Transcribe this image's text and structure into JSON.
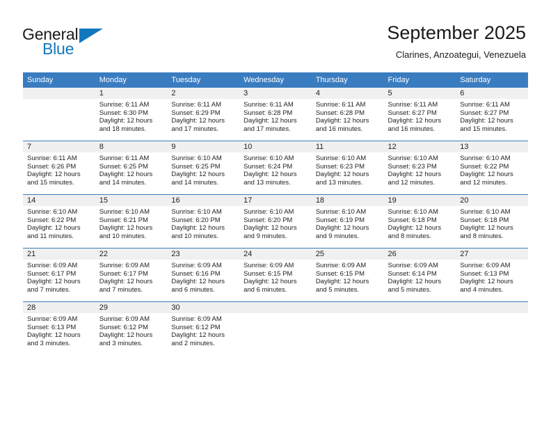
{
  "brand": {
    "name_part1": "General",
    "name_part2": "Blue",
    "triangle_icon": "triangle-icon",
    "color_primary": "#1278be",
    "color_text": "#1a1a1a"
  },
  "header": {
    "title": "September 2025",
    "subtitle": "Clarines, Anzoategui, Venezuela"
  },
  "theme": {
    "header_row_bg": "#3a7cc0",
    "daynum_band_bg": "#f0f0f0",
    "grid_line": "#3a7cc0",
    "page_bg": "#ffffff"
  },
  "weekdays": [
    "Sunday",
    "Monday",
    "Tuesday",
    "Wednesday",
    "Thursday",
    "Friday",
    "Saturday"
  ],
  "weeks": [
    [
      {
        "day": "",
        "sunrise": "",
        "sunset": "",
        "daylight_line1": "",
        "daylight_line2": ""
      },
      {
        "day": "1",
        "sunrise": "Sunrise: 6:11 AM",
        "sunset": "Sunset: 6:30 PM",
        "daylight_line1": "Daylight: 12 hours",
        "daylight_line2": "and 18 minutes."
      },
      {
        "day": "2",
        "sunrise": "Sunrise: 6:11 AM",
        "sunset": "Sunset: 6:29 PM",
        "daylight_line1": "Daylight: 12 hours",
        "daylight_line2": "and 17 minutes."
      },
      {
        "day": "3",
        "sunrise": "Sunrise: 6:11 AM",
        "sunset": "Sunset: 6:28 PM",
        "daylight_line1": "Daylight: 12 hours",
        "daylight_line2": "and 17 minutes."
      },
      {
        "day": "4",
        "sunrise": "Sunrise: 6:11 AM",
        "sunset": "Sunset: 6:28 PM",
        "daylight_line1": "Daylight: 12 hours",
        "daylight_line2": "and 16 minutes."
      },
      {
        "day": "5",
        "sunrise": "Sunrise: 6:11 AM",
        "sunset": "Sunset: 6:27 PM",
        "daylight_line1": "Daylight: 12 hours",
        "daylight_line2": "and 16 minutes."
      },
      {
        "day": "6",
        "sunrise": "Sunrise: 6:11 AM",
        "sunset": "Sunset: 6:27 PM",
        "daylight_line1": "Daylight: 12 hours",
        "daylight_line2": "and 15 minutes."
      }
    ],
    [
      {
        "day": "7",
        "sunrise": "Sunrise: 6:11 AM",
        "sunset": "Sunset: 6:26 PM",
        "daylight_line1": "Daylight: 12 hours",
        "daylight_line2": "and 15 minutes."
      },
      {
        "day": "8",
        "sunrise": "Sunrise: 6:11 AM",
        "sunset": "Sunset: 6:25 PM",
        "daylight_line1": "Daylight: 12 hours",
        "daylight_line2": "and 14 minutes."
      },
      {
        "day": "9",
        "sunrise": "Sunrise: 6:10 AM",
        "sunset": "Sunset: 6:25 PM",
        "daylight_line1": "Daylight: 12 hours",
        "daylight_line2": "and 14 minutes."
      },
      {
        "day": "10",
        "sunrise": "Sunrise: 6:10 AM",
        "sunset": "Sunset: 6:24 PM",
        "daylight_line1": "Daylight: 12 hours",
        "daylight_line2": "and 13 minutes."
      },
      {
        "day": "11",
        "sunrise": "Sunrise: 6:10 AM",
        "sunset": "Sunset: 6:23 PM",
        "daylight_line1": "Daylight: 12 hours",
        "daylight_line2": "and 13 minutes."
      },
      {
        "day": "12",
        "sunrise": "Sunrise: 6:10 AM",
        "sunset": "Sunset: 6:23 PM",
        "daylight_line1": "Daylight: 12 hours",
        "daylight_line2": "and 12 minutes."
      },
      {
        "day": "13",
        "sunrise": "Sunrise: 6:10 AM",
        "sunset": "Sunset: 6:22 PM",
        "daylight_line1": "Daylight: 12 hours",
        "daylight_line2": "and 12 minutes."
      }
    ],
    [
      {
        "day": "14",
        "sunrise": "Sunrise: 6:10 AM",
        "sunset": "Sunset: 6:22 PM",
        "daylight_line1": "Daylight: 12 hours",
        "daylight_line2": "and 11 minutes."
      },
      {
        "day": "15",
        "sunrise": "Sunrise: 6:10 AM",
        "sunset": "Sunset: 6:21 PM",
        "daylight_line1": "Daylight: 12 hours",
        "daylight_line2": "and 10 minutes."
      },
      {
        "day": "16",
        "sunrise": "Sunrise: 6:10 AM",
        "sunset": "Sunset: 6:20 PM",
        "daylight_line1": "Daylight: 12 hours",
        "daylight_line2": "and 10 minutes."
      },
      {
        "day": "17",
        "sunrise": "Sunrise: 6:10 AM",
        "sunset": "Sunset: 6:20 PM",
        "daylight_line1": "Daylight: 12 hours",
        "daylight_line2": "and 9 minutes."
      },
      {
        "day": "18",
        "sunrise": "Sunrise: 6:10 AM",
        "sunset": "Sunset: 6:19 PM",
        "daylight_line1": "Daylight: 12 hours",
        "daylight_line2": "and 9 minutes."
      },
      {
        "day": "19",
        "sunrise": "Sunrise: 6:10 AM",
        "sunset": "Sunset: 6:18 PM",
        "daylight_line1": "Daylight: 12 hours",
        "daylight_line2": "and 8 minutes."
      },
      {
        "day": "20",
        "sunrise": "Sunrise: 6:10 AM",
        "sunset": "Sunset: 6:18 PM",
        "daylight_line1": "Daylight: 12 hours",
        "daylight_line2": "and 8 minutes."
      }
    ],
    [
      {
        "day": "21",
        "sunrise": "Sunrise: 6:09 AM",
        "sunset": "Sunset: 6:17 PM",
        "daylight_line1": "Daylight: 12 hours",
        "daylight_line2": "and 7 minutes."
      },
      {
        "day": "22",
        "sunrise": "Sunrise: 6:09 AM",
        "sunset": "Sunset: 6:17 PM",
        "daylight_line1": "Daylight: 12 hours",
        "daylight_line2": "and 7 minutes."
      },
      {
        "day": "23",
        "sunrise": "Sunrise: 6:09 AM",
        "sunset": "Sunset: 6:16 PM",
        "daylight_line1": "Daylight: 12 hours",
        "daylight_line2": "and 6 minutes."
      },
      {
        "day": "24",
        "sunrise": "Sunrise: 6:09 AM",
        "sunset": "Sunset: 6:15 PM",
        "daylight_line1": "Daylight: 12 hours",
        "daylight_line2": "and 6 minutes."
      },
      {
        "day": "25",
        "sunrise": "Sunrise: 6:09 AM",
        "sunset": "Sunset: 6:15 PM",
        "daylight_line1": "Daylight: 12 hours",
        "daylight_line2": "and 5 minutes."
      },
      {
        "day": "26",
        "sunrise": "Sunrise: 6:09 AM",
        "sunset": "Sunset: 6:14 PM",
        "daylight_line1": "Daylight: 12 hours",
        "daylight_line2": "and 5 minutes."
      },
      {
        "day": "27",
        "sunrise": "Sunrise: 6:09 AM",
        "sunset": "Sunset: 6:13 PM",
        "daylight_line1": "Daylight: 12 hours",
        "daylight_line2": "and 4 minutes."
      }
    ],
    [
      {
        "day": "28",
        "sunrise": "Sunrise: 6:09 AM",
        "sunset": "Sunset: 6:13 PM",
        "daylight_line1": "Daylight: 12 hours",
        "daylight_line2": "and 3 minutes."
      },
      {
        "day": "29",
        "sunrise": "Sunrise: 6:09 AM",
        "sunset": "Sunset: 6:12 PM",
        "daylight_line1": "Daylight: 12 hours",
        "daylight_line2": "and 3 minutes."
      },
      {
        "day": "30",
        "sunrise": "Sunrise: 6:09 AM",
        "sunset": "Sunset: 6:12 PM",
        "daylight_line1": "Daylight: 12 hours",
        "daylight_line2": "and 2 minutes."
      },
      {
        "day": "",
        "sunrise": "",
        "sunset": "",
        "daylight_line1": "",
        "daylight_line2": ""
      },
      {
        "day": "",
        "sunrise": "",
        "sunset": "",
        "daylight_line1": "",
        "daylight_line2": ""
      },
      {
        "day": "",
        "sunrise": "",
        "sunset": "",
        "daylight_line1": "",
        "daylight_line2": ""
      },
      {
        "day": "",
        "sunrise": "",
        "sunset": "",
        "daylight_line1": "",
        "daylight_line2": ""
      }
    ]
  ]
}
